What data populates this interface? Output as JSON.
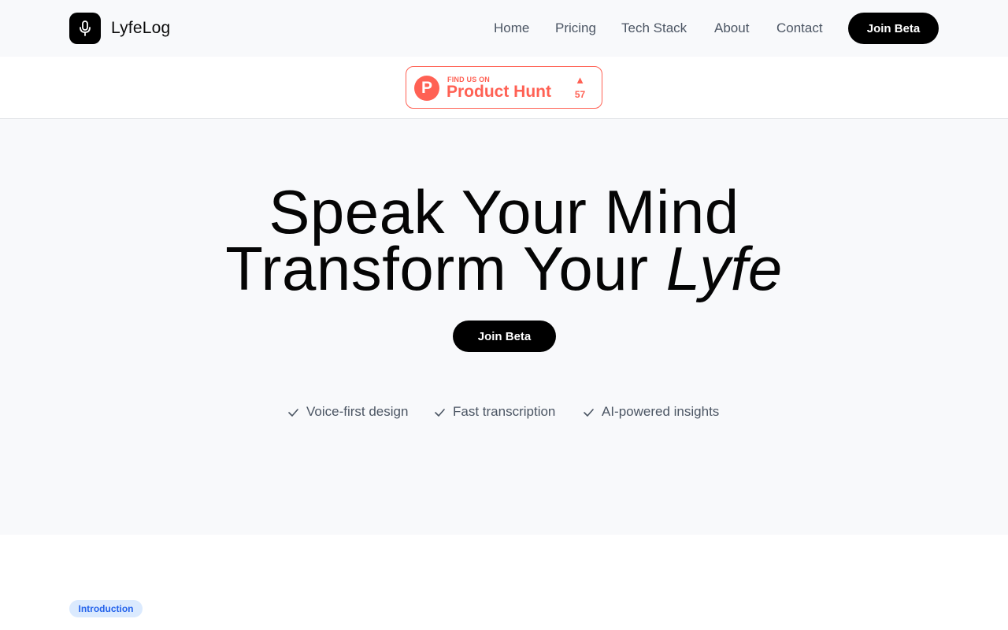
{
  "brand": {
    "name": "LyfeLog",
    "logo_icon": "microphone-icon"
  },
  "nav": {
    "links": [
      "Home",
      "Pricing",
      "Tech Stack",
      "About",
      "Contact"
    ],
    "cta_label": "Join Beta"
  },
  "product_hunt": {
    "small_text": "FIND US ON",
    "big_text": "Product Hunt",
    "logo_letter": "P",
    "upvote_icon": "▲",
    "upvotes": "57",
    "color": "#ff6154"
  },
  "hero": {
    "line1": "Speak Your Mind",
    "line2_prefix": "Transform Your",
    "line2_emphasis": "Lyfe",
    "cta_label": "Join Beta",
    "features": [
      "Voice-first design",
      "Fast transcription",
      "AI-powered insights"
    ]
  },
  "intro_section": {
    "pill_label": "Introduction"
  },
  "colors": {
    "primary": "#000000",
    "muted_text": "#4b5563",
    "background_alt": "#f8f9fb",
    "pill_bg": "#dbeafe",
    "pill_text": "#2563eb"
  }
}
